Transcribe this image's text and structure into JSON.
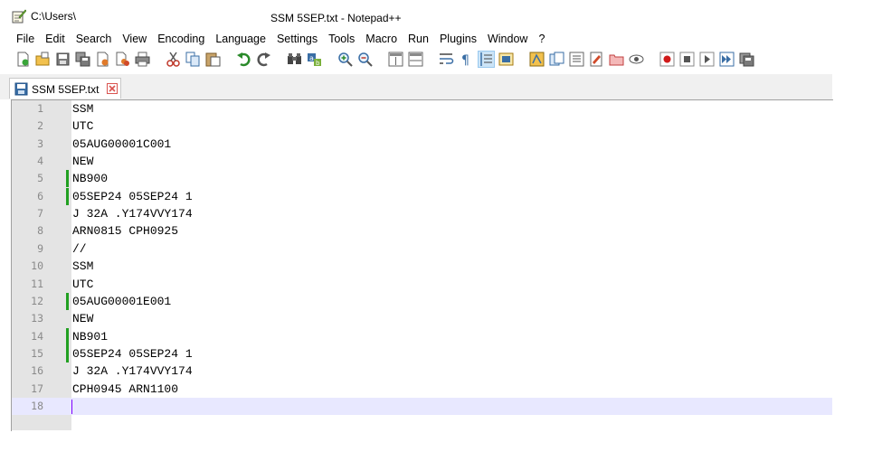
{
  "window": {
    "title_path": "C:\\Users\\",
    "title": "SSM 5SEP.txt - Notepad++"
  },
  "menu": [
    "File",
    "Edit",
    "Search",
    "View",
    "Encoding",
    "Language",
    "Settings",
    "Tools",
    "Macro",
    "Run",
    "Plugins",
    "Window",
    "?"
  ],
  "toolbar": {
    "icons": [
      "new-file-icon",
      "open-file-icon",
      "save-icon",
      "save-all-icon",
      "close-icon",
      "close-all-icon",
      "print-icon",
      "cut-icon",
      "copy-icon",
      "paste-icon",
      "undo-icon",
      "redo-icon",
      "find-icon",
      "replace-icon",
      "zoom-in-icon",
      "zoom-out-icon",
      "sync-vertical-icon",
      "sync-horizontal-icon",
      "word-wrap-icon",
      "show-all-chars-icon",
      "indent-guide-icon",
      "udl-icon",
      "doc-map-icon",
      "function-list-icon",
      "folder-as-workspace-icon",
      "doc-list-icon",
      "monitoring-icon",
      "record-macro-icon",
      "stop-record-icon",
      "play-macro-icon",
      "run-macro-multiple-icon",
      "save-macro-icon"
    ]
  },
  "tab": {
    "label": "SSM 5SEP.txt"
  },
  "editor": {
    "lines": [
      {
        "n": "1",
        "text": "SSM",
        "changed": false
      },
      {
        "n": "2",
        "text": "UTC",
        "changed": false
      },
      {
        "n": "3",
        "text": "05AUG00001C001",
        "changed": false
      },
      {
        "n": "4",
        "text": "NEW",
        "changed": false
      },
      {
        "n": "5",
        "text": "NB900",
        "changed": true
      },
      {
        "n": "6",
        "text": "05SEP24 05SEP24 1",
        "changed": true
      },
      {
        "n": "7",
        "text": "J 32A .Y174VVY174",
        "changed": false
      },
      {
        "n": "8",
        "text": "ARN0815 CPH0925",
        "changed": false
      },
      {
        "n": "9",
        "text": "//",
        "changed": false
      },
      {
        "n": "10",
        "text": "SSM",
        "changed": false
      },
      {
        "n": "11",
        "text": "UTC",
        "changed": false
      },
      {
        "n": "12",
        "text": "05AUG00001E001",
        "changed": true
      },
      {
        "n": "13",
        "text": "NEW",
        "changed": false
      },
      {
        "n": "14",
        "text": "NB901",
        "changed": true
      },
      {
        "n": "15",
        "text": "05SEP24 05SEP24 1",
        "changed": true
      },
      {
        "n": "16",
        "text": "J 32A .Y174VVY174",
        "changed": false
      },
      {
        "n": "17",
        "text": "CPH0945 ARN1100",
        "changed": false
      },
      {
        "n": "18",
        "text": "",
        "changed": false
      }
    ],
    "current_line": "18"
  },
  "colors": {
    "gutter": "#e4e4e4",
    "change_marker": "#21a021",
    "current_line": "#e8e8ff",
    "caret": "#8000ff"
  }
}
